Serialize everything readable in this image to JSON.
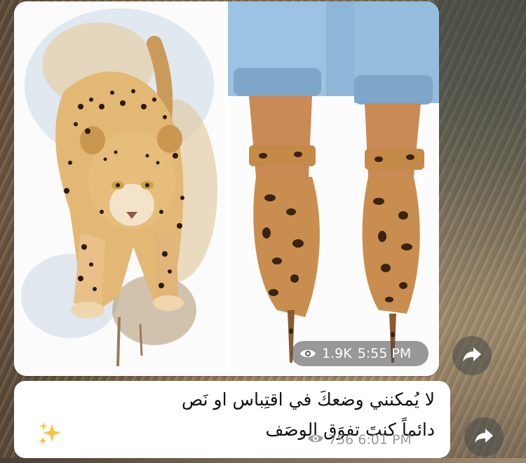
{
  "media_message": {
    "views": "1.9K",
    "time": "5:55 PM",
    "left_image": "leopard-painting",
    "right_image": "leopard-print-heels"
  },
  "text_message": {
    "line1": "لا يُمكنني وضعكَ في اقتِباس او نَص",
    "line2": "دائماً كنتَ تفوَق الوصَف",
    "emoji": "sparkles",
    "views": "756",
    "time": "6:01 PM"
  },
  "icons": {
    "views": "eye-icon",
    "share": "share-arrow-icon"
  },
  "colors": {
    "bubble": "#ffffff",
    "meta_text": "#9a9a9a",
    "pill": "#464646"
  }
}
